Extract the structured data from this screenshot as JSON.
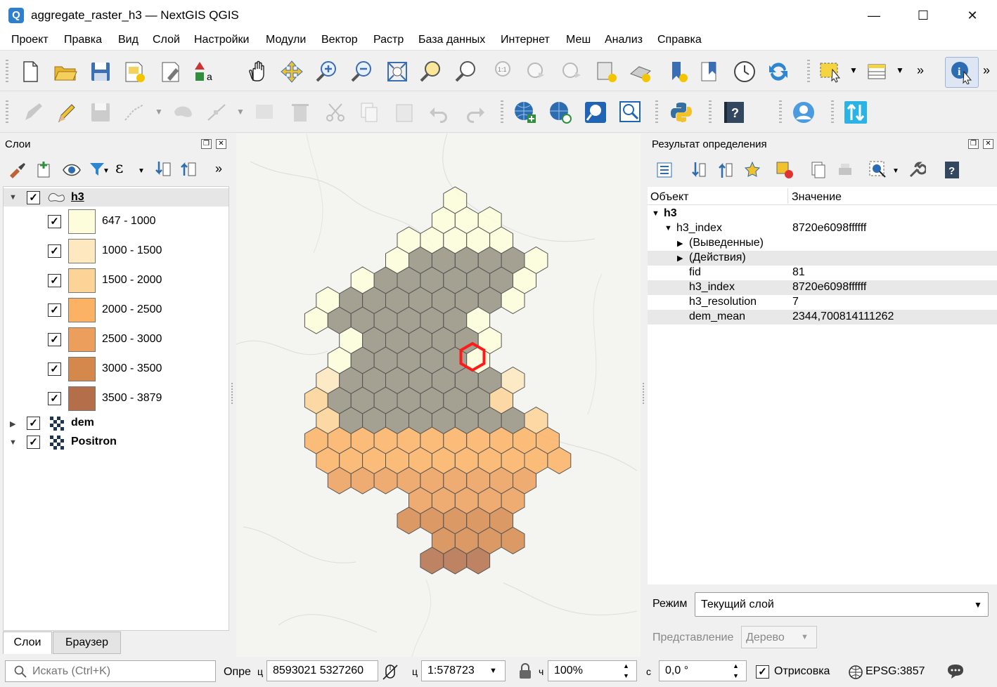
{
  "window": {
    "title": "aggregate_raster_h3 — NextGIS QGIS",
    "icon": "Q"
  },
  "controls": {
    "minimize": "—",
    "maximize": "☐",
    "close": "✕"
  },
  "menu": [
    "Проект",
    "Правка",
    "Вид",
    "Слой",
    "Настройки",
    "Модули",
    "Вектор",
    "Растр",
    "База данных",
    "Интернет",
    "Меш",
    "Анализ",
    "Справка"
  ],
  "layers_panel": {
    "title": "Слои",
    "tabs": [
      "Слои",
      "Браузер"
    ]
  },
  "layers": [
    {
      "name": "h3",
      "classes": [
        {
          "label": "647 - 1000",
          "color": "#fdfddc"
        },
        {
          "label": "1000 - 1500",
          "color": "#fde8bf"
        },
        {
          "label": "1500 - 2000",
          "color": "#fdd497"
        },
        {
          "label": "2000 - 2500",
          "color": "#fcb265"
        },
        {
          "label": "2500 - 3000",
          "color": "#ec9e5c"
        },
        {
          "label": "3000 - 3500",
          "color": "#d5884c"
        },
        {
          "label": "3500 - 3879",
          "color": "#b46f4a"
        }
      ]
    },
    {
      "name": "dem"
    },
    {
      "name": "Positron"
    }
  ],
  "identify": {
    "title": "Результат определения",
    "col_object": "Объект",
    "col_value": "Значение",
    "rows": [
      {
        "key": "h3",
        "value": ""
      },
      {
        "key": "h3_index",
        "value": "8720e6098ffffff"
      },
      {
        "key": "(Выведенные)",
        "value": ""
      },
      {
        "key": "(Действия)",
        "value": ""
      },
      {
        "key": "fid",
        "value": "81"
      },
      {
        "key": "h3_index",
        "value": "8720e6098ffffff"
      },
      {
        "key": "h3_resolution",
        "value": "7"
      },
      {
        "key": "dem_mean",
        "value": "2344,700814111262"
      }
    ],
    "mode_label": "Режим",
    "mode_value": "Текущий слой",
    "view_label": "Представление",
    "view_value": "Дерево"
  },
  "status": {
    "search_placeholder": "Искать (Ctrl+K)",
    "coord_label": "Опре",
    "coord_short": "ц",
    "coord_value": "8593021  5327260",
    "scale_label": "ц",
    "scale_value": "1:578723",
    "mag_label": "ч",
    "mag_value": "100%",
    "rot_label": "с",
    "rot_value": "0,0 °",
    "render_label": "Отрисовка",
    "crs": "EPSG:3857"
  }
}
